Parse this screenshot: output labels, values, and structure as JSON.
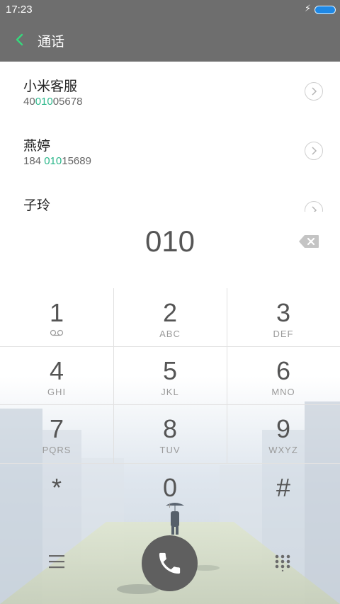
{
  "status_bar": {
    "time": "17:23"
  },
  "header": {
    "title": "通话"
  },
  "contacts": [
    {
      "name": "小米客服",
      "number_pre": "40",
      "number_match": "010",
      "number_post": "05678"
    },
    {
      "name": "燕婷",
      "number_pre": "184 ",
      "number_match": "010",
      "number_post": "15689"
    },
    {
      "name": "子玲",
      "number_pre": "",
      "number_match": "",
      "number_post": ""
    }
  ],
  "dial": {
    "number": "010"
  },
  "keypad": [
    {
      "digit": "1",
      "letters": ""
    },
    {
      "digit": "2",
      "letters": "ABC"
    },
    {
      "digit": "3",
      "letters": "DEF"
    },
    {
      "digit": "4",
      "letters": "GHI"
    },
    {
      "digit": "5",
      "letters": "JKL"
    },
    {
      "digit": "6",
      "letters": "MNO"
    },
    {
      "digit": "7",
      "letters": "PQRS"
    },
    {
      "digit": "8",
      "letters": "TUV"
    },
    {
      "digit": "9",
      "letters": "WXYZ"
    },
    {
      "digit": "*",
      "letters": ""
    },
    {
      "digit": "0",
      "letters": "+"
    },
    {
      "digit": "#",
      "letters": ""
    }
  ],
  "colors": {
    "accent": "#2cb78b",
    "header_bg": "#6e6e6e",
    "call_button": "#5f5f5f"
  },
  "icons": {
    "back": "chevron-left-icon",
    "backspace": "backspace-icon",
    "menu": "menu-icon",
    "call": "phone-icon",
    "dialpad": "dialpad-icon",
    "voicemail": "voicemail-icon"
  }
}
